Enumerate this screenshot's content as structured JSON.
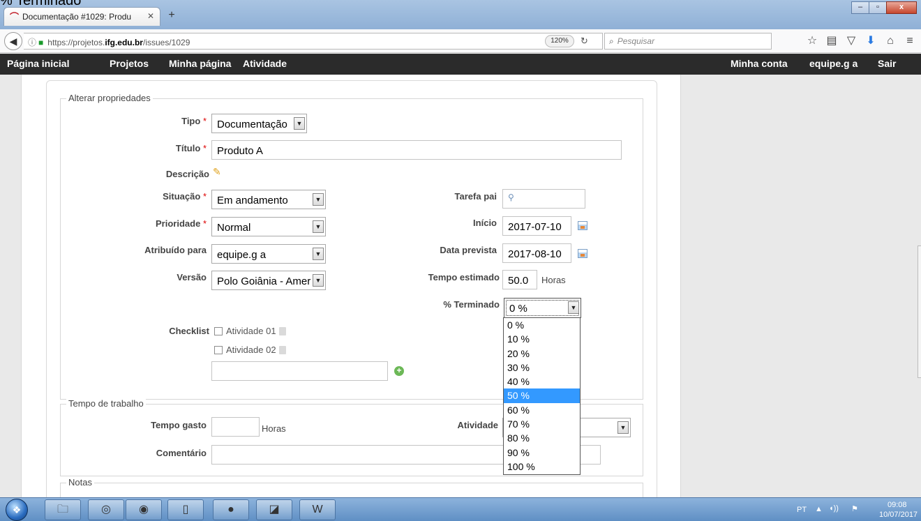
{
  "top_caption": "% Terminado",
  "browser": {
    "tab_title": "Documentação #1029: Produ",
    "tab_close": "✕",
    "new_tab": "+",
    "url_prefix": "https://projetos.",
    "url_host": "ifg.edu.br",
    "url_path": "/issues/1029",
    "zoom": "120%",
    "search_placeholder": "Pesquisar"
  },
  "menu": {
    "home": "Página inicial",
    "projects": "Projetos",
    "my_page": "Minha página",
    "activity": "Atividade",
    "my_account": "Minha conta",
    "user": "equipe.g a",
    "logout": "Sair"
  },
  "form": {
    "section_properties": "Alterar propriedades",
    "tipo_label": "Tipo",
    "tipo_value": "Documentação",
    "titulo_label": "Título",
    "titulo_value": "Produto A",
    "descricao_label": "Descrição",
    "situacao_label": "Situação",
    "situacao_value": "Em andamento",
    "prioridade_label": "Prioridade",
    "prioridade_value": "Normal",
    "atribuido_label": "Atribuído para",
    "atribuido_value": "equipe.g a",
    "versao_label": "Versão",
    "versao_value": "Polo Goiânia - Amer",
    "tarefa_pai_label": "Tarefa pai",
    "inicio_label": "Início",
    "inicio_value": "2017-07-10",
    "data_prevista_label": "Data prevista",
    "data_prevista_value": "2017-08-10",
    "tempo_estimado_label": "Tempo estimado",
    "tempo_estimado_value": "50.0",
    "horas_unit": "Horas",
    "terminado_label": "% Terminado",
    "terminado_value": "0 %",
    "checklist_label": "Checklist",
    "checklist_items": [
      "Atividade 01",
      "Atividade 02"
    ],
    "section_time": "Tempo de trabalho",
    "tempo_gasto_label": "Tempo gasto",
    "tempo_gasto_unit": "Horas",
    "atividade_label": "Atividade",
    "comentario_label": "Comentário",
    "section_notes": "Notas",
    "required_mark": "*"
  },
  "dropdown": {
    "options": [
      "0 %",
      "10 %",
      "20 %",
      "30 %",
      "40 %",
      "50 %",
      "60 %",
      "70 %",
      "80 %",
      "90 %",
      "100 %"
    ],
    "highlighted": "50 %"
  },
  "taskbar": {
    "lang": "PT",
    "time": "09:08",
    "date": "10/07/2017"
  }
}
